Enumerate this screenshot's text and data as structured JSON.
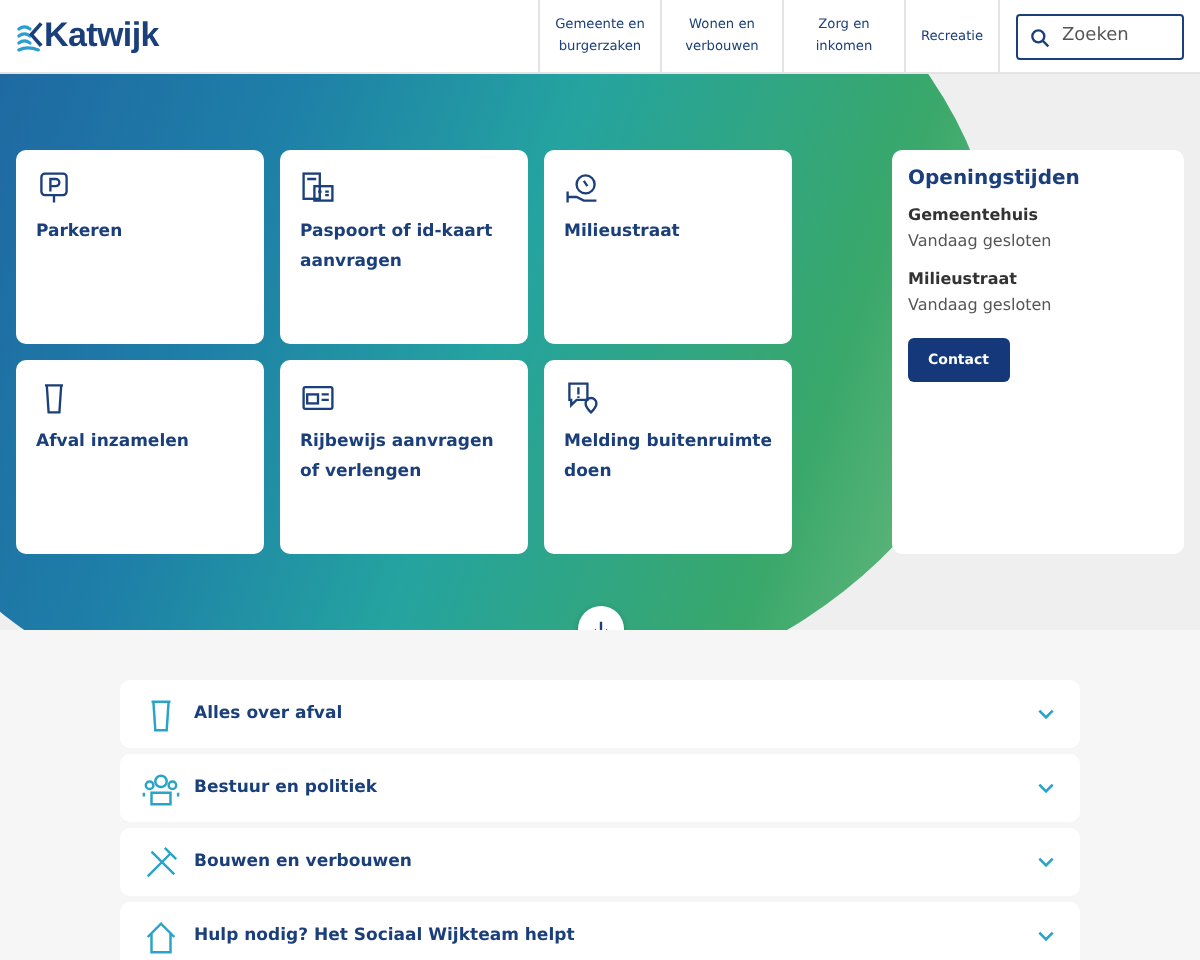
{
  "header": {
    "logo": "Katwijk",
    "nav": [
      {
        "label": "Gemeente en burgerzaken"
      },
      {
        "label": "Wonen en verbouwen"
      },
      {
        "label": "Zorg en inkomen"
      },
      {
        "label": "Recreatie"
      }
    ],
    "search": {
      "placeholder": "Zoeken"
    }
  },
  "tiles": [
    {
      "kind": "parking",
      "label": "Parkeren"
    },
    {
      "kind": "passport",
      "label": "Paspoort of id-kaart aanvragen"
    },
    {
      "kind": "recycle",
      "label": "Milieustraat"
    },
    {
      "kind": "bin",
      "label": "Afval inzamelen"
    },
    {
      "kind": "license",
      "label": "Rijbewijs aanvragen of verlengen"
    },
    {
      "kind": "report",
      "label": "Melding buitenruimte doen"
    }
  ],
  "opening_hours": {
    "title": "Openingstijden",
    "places": [
      {
        "name": "Gemeentehuis",
        "status": "Vandaag gesloten"
      },
      {
        "name": "Milieustraat",
        "status": "Vandaag gesloten"
      }
    ],
    "button": "Contact"
  },
  "topics": [
    {
      "kind": "bin",
      "label": "Alles over afval",
      "expanded": false
    },
    {
      "kind": "people",
      "label": "Bestuur en politiek",
      "expanded": false
    },
    {
      "kind": "tools",
      "label": "Bouwen en verbouwen",
      "expanded": false
    },
    {
      "kind": "house",
      "label": "Hulp nodig? Het Sociaal Wijkteam helpt",
      "expanded": false
    }
  ]
}
